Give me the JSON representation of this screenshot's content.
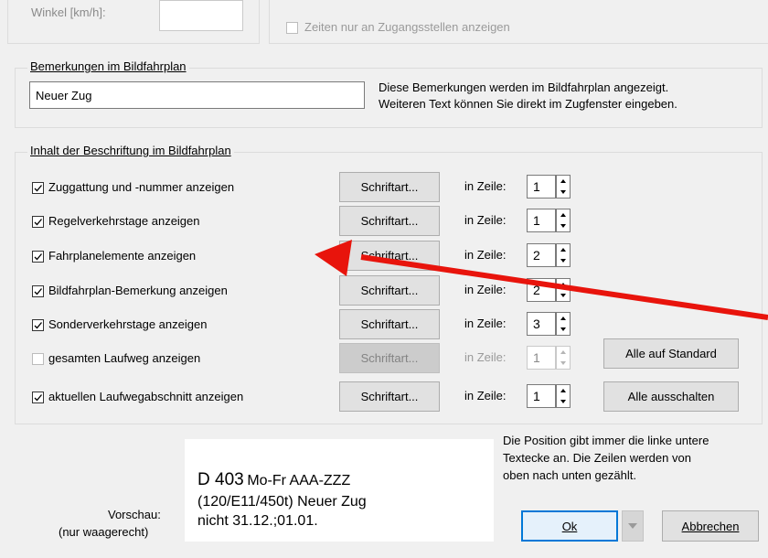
{
  "top": {
    "winkel_label": "Winkel [km/h]:",
    "zeiten_label": "Zeiten nur an Zugangsstellen anzeigen"
  },
  "remarks": {
    "group_label": "Bemerkungen im Bildfahrplan",
    "input_value": "Neuer Zug",
    "hint_line1": "Diese Bemerkungen werden im Bildfahrplan angezeigt.",
    "hint_line2": "Weiteren Text können Sie direkt im Zugfenster eingeben."
  },
  "content": {
    "group_label": "Inhalt der Beschriftung im Bildfahrplan",
    "font_button_label": "Schriftart...",
    "row_label": "in Zeile:",
    "rows": [
      {
        "label": "Zuggattung und -nummer anzeigen",
        "checked": true,
        "enabled": true,
        "line": "1"
      },
      {
        "label": "Regelverkehrstage anzeigen",
        "checked": true,
        "enabled": true,
        "line": "1"
      },
      {
        "label": "Fahrplanelemente anzeigen",
        "checked": true,
        "enabled": true,
        "line": "2"
      },
      {
        "label": "Bildfahrplan-Bemerkung anzeigen",
        "checked": true,
        "enabled": true,
        "line": "2"
      },
      {
        "label": "Sonderverkehrstage anzeigen",
        "checked": true,
        "enabled": true,
        "line": "3"
      },
      {
        "label": "gesamten Laufweg anzeigen",
        "checked": false,
        "enabled": false,
        "line": "1"
      },
      {
        "label": "aktuellen Laufwegabschnitt anzeigen",
        "checked": true,
        "enabled": true,
        "line": "1"
      }
    ],
    "standard_button": "Alle auf Standard",
    "off_button": "Alle ausschalten"
  },
  "preview": {
    "label_line1": "Vorschau:",
    "label_line2": "(nur waagerecht)",
    "line1_big": "D 403",
    "line1_rest": "Mo-Fr AAA-ZZZ",
    "line2": "(120/E11/450t) Neuer Zug",
    "line3": "nicht 31.12.;01.01."
  },
  "info": {
    "line1": "Die Position gibt immer die linke untere",
    "line2": "Textecke an. Die Zeilen werden von",
    "line3": "oben nach unten gezählt."
  },
  "buttons": {
    "ok": "Ok",
    "cancel": "Abbrechen"
  },
  "colors": {
    "arrow": "#e8140c",
    "ok_border": "#0078d7",
    "window_bg": "#f0f0f0"
  }
}
